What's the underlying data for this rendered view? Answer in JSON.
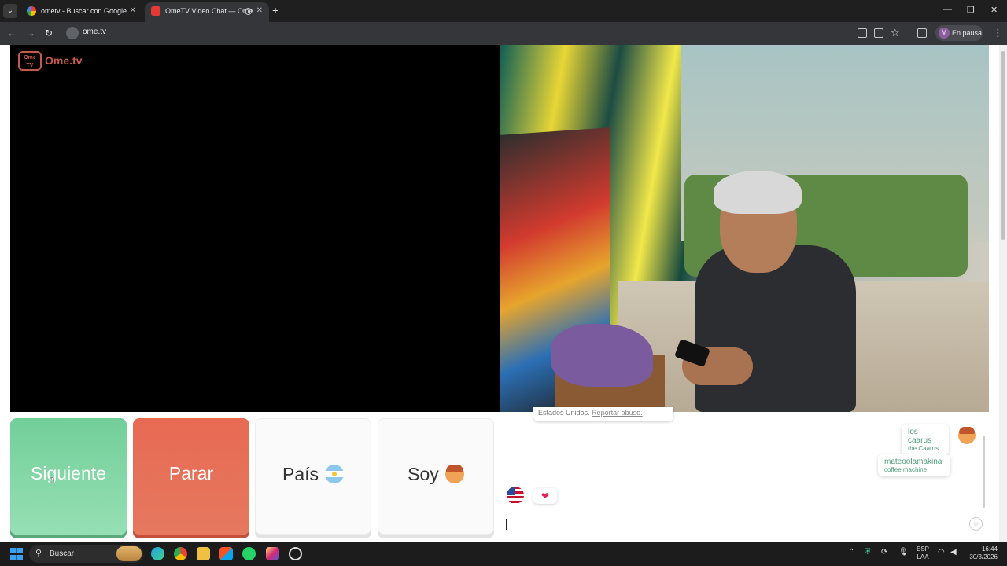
{
  "browser": {
    "tabs": [
      {
        "title": "ometv - Buscar con Google",
        "active": false
      },
      {
        "title": "OmeTV Video Chat — Ome",
        "active": true
      }
    ],
    "url": "ome.tv",
    "profile_label": "En pausa",
    "profile_initial": "M"
  },
  "site": {
    "logo_text": "Ome.tv",
    "logo_badge": "Ome TV"
  },
  "controls": {
    "next_label": "Siguiente",
    "stop_label": "Parar",
    "country_label": "País",
    "gender_label": "Soy"
  },
  "chat": {
    "system_note_prefix": "Estados Unidos.",
    "system_note_link": "Reportar abuso.",
    "messages": [
      {
        "text": "los caarus",
        "translation": "the Caarus",
        "from": "me"
      },
      {
        "text": "mateoolamakina",
        "translation": "coffee machine",
        "from": "me"
      },
      {
        "text": "❤",
        "from": "stranger",
        "stranger_country": "United States"
      }
    ],
    "input_value": ""
  },
  "taskbar": {
    "search_label": "Buscar",
    "language_line1": "ESP",
    "language_line2": "LAA",
    "time": "16:44",
    "date": "30/3/2026"
  },
  "colors": {
    "next_button": "#72cf99",
    "stop_button": "#e86a53",
    "brand": "#c55a4b",
    "chat_text": "#4d9a7b"
  }
}
